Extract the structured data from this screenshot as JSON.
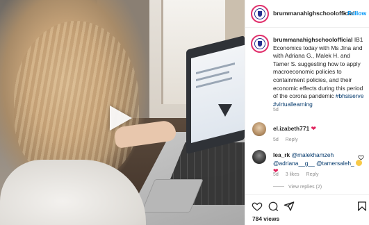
{
  "post": {
    "username": "brummanahighschoolofficial",
    "username_header": "brummanahighschoolofficial",
    "follow_separator": "•",
    "follow_label": "Follow",
    "caption_text": "IB1 Economics today with Ms Jina and with Adriana G., Malek H. and Tamer S. suggesting how to apply macroeconomic policies to containment policies, and their economic effects during this period of the corona pandemic",
    "hashtag_1": "#bhsiserve",
    "hashtag_2": "#virtuallearning",
    "age": "5d",
    "views_label": "784 views"
  },
  "comments": [
    {
      "username": "el.izabeth771",
      "text": "",
      "emoji": "heart",
      "age": "5d",
      "reply_label": "Reply"
    },
    {
      "username": "lea_rk",
      "mentions": [
        "@malekhamzeh",
        "@adriana__g__",
        "@tamersaleh_"
      ],
      "emoji": "smile-heart",
      "age": "5d",
      "likes_label": "3 likes",
      "reply_label": "Reply",
      "view_replies_label": "View replies (2)"
    }
  ],
  "icons": {
    "like": "heart-icon",
    "comment": "comment-icon",
    "share": "share-icon",
    "save": "bookmark-icon",
    "play": "play-icon"
  },
  "colors": {
    "link": "#0095f6",
    "hashtag": "#00376b",
    "muted": "#8e8e8e",
    "avatar_ring": "#e1306c"
  }
}
